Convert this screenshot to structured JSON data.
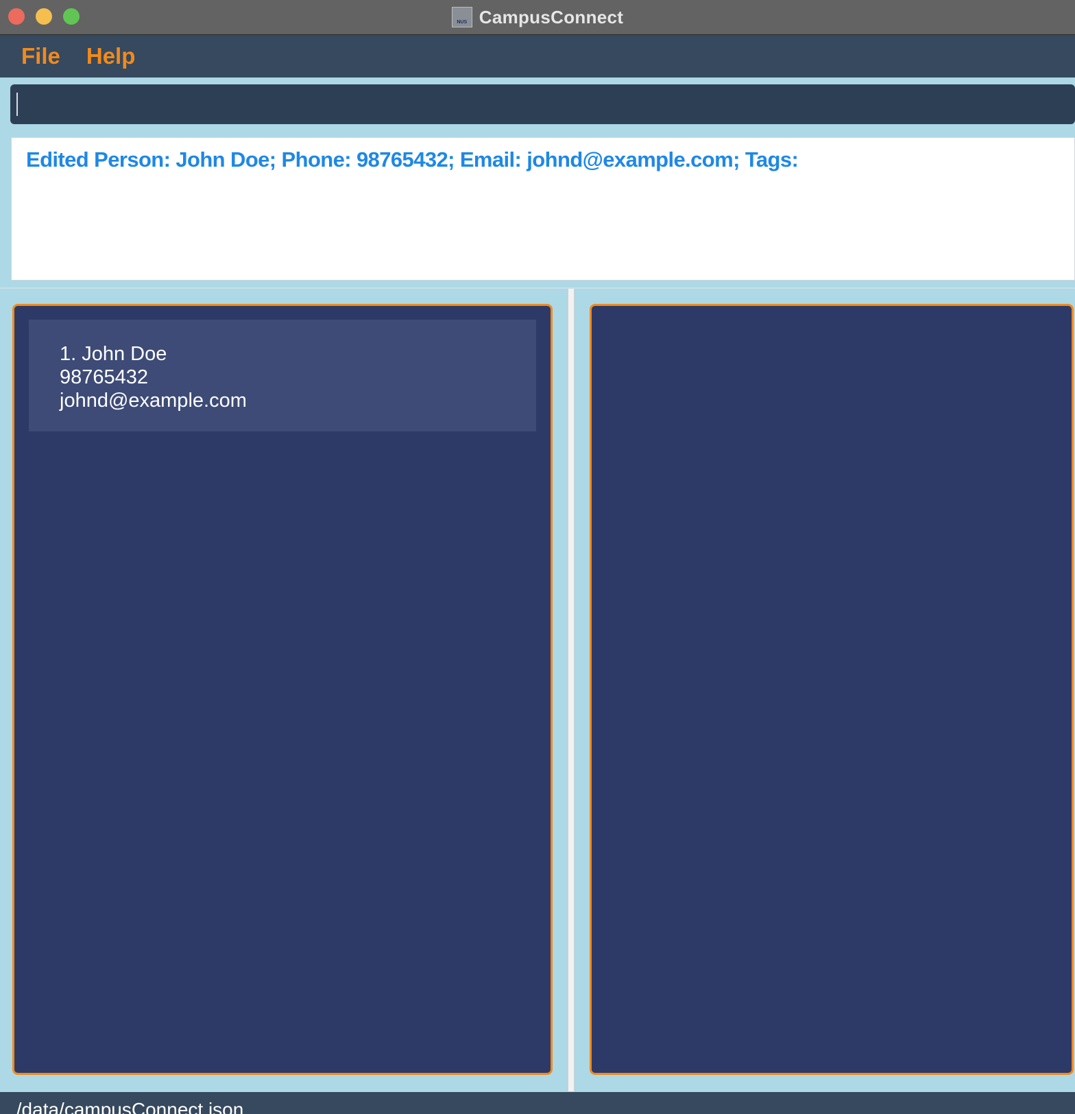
{
  "window": {
    "title": "CampusConnect",
    "app_icon_text": "NUS"
  },
  "menu": {
    "items": [
      "File",
      "Help"
    ]
  },
  "command_box": {
    "value": "",
    "placeholder": ""
  },
  "result_display": {
    "text": "Edited Person: John Doe; Phone: 98765432; Email: johnd@example.com; Tags:"
  },
  "person_list": [
    {
      "index_name": "1. John Doe",
      "phone": "98765432",
      "email": "johnd@example.com"
    }
  ],
  "status_bar": {
    "file_path": "./data/campusConnect.json"
  },
  "colors": {
    "accent_orange": "#f28a1c",
    "result_text_blue": "#1e88e5",
    "panel_navy": "#2d3a67",
    "background_light_blue": "#add8e6"
  }
}
